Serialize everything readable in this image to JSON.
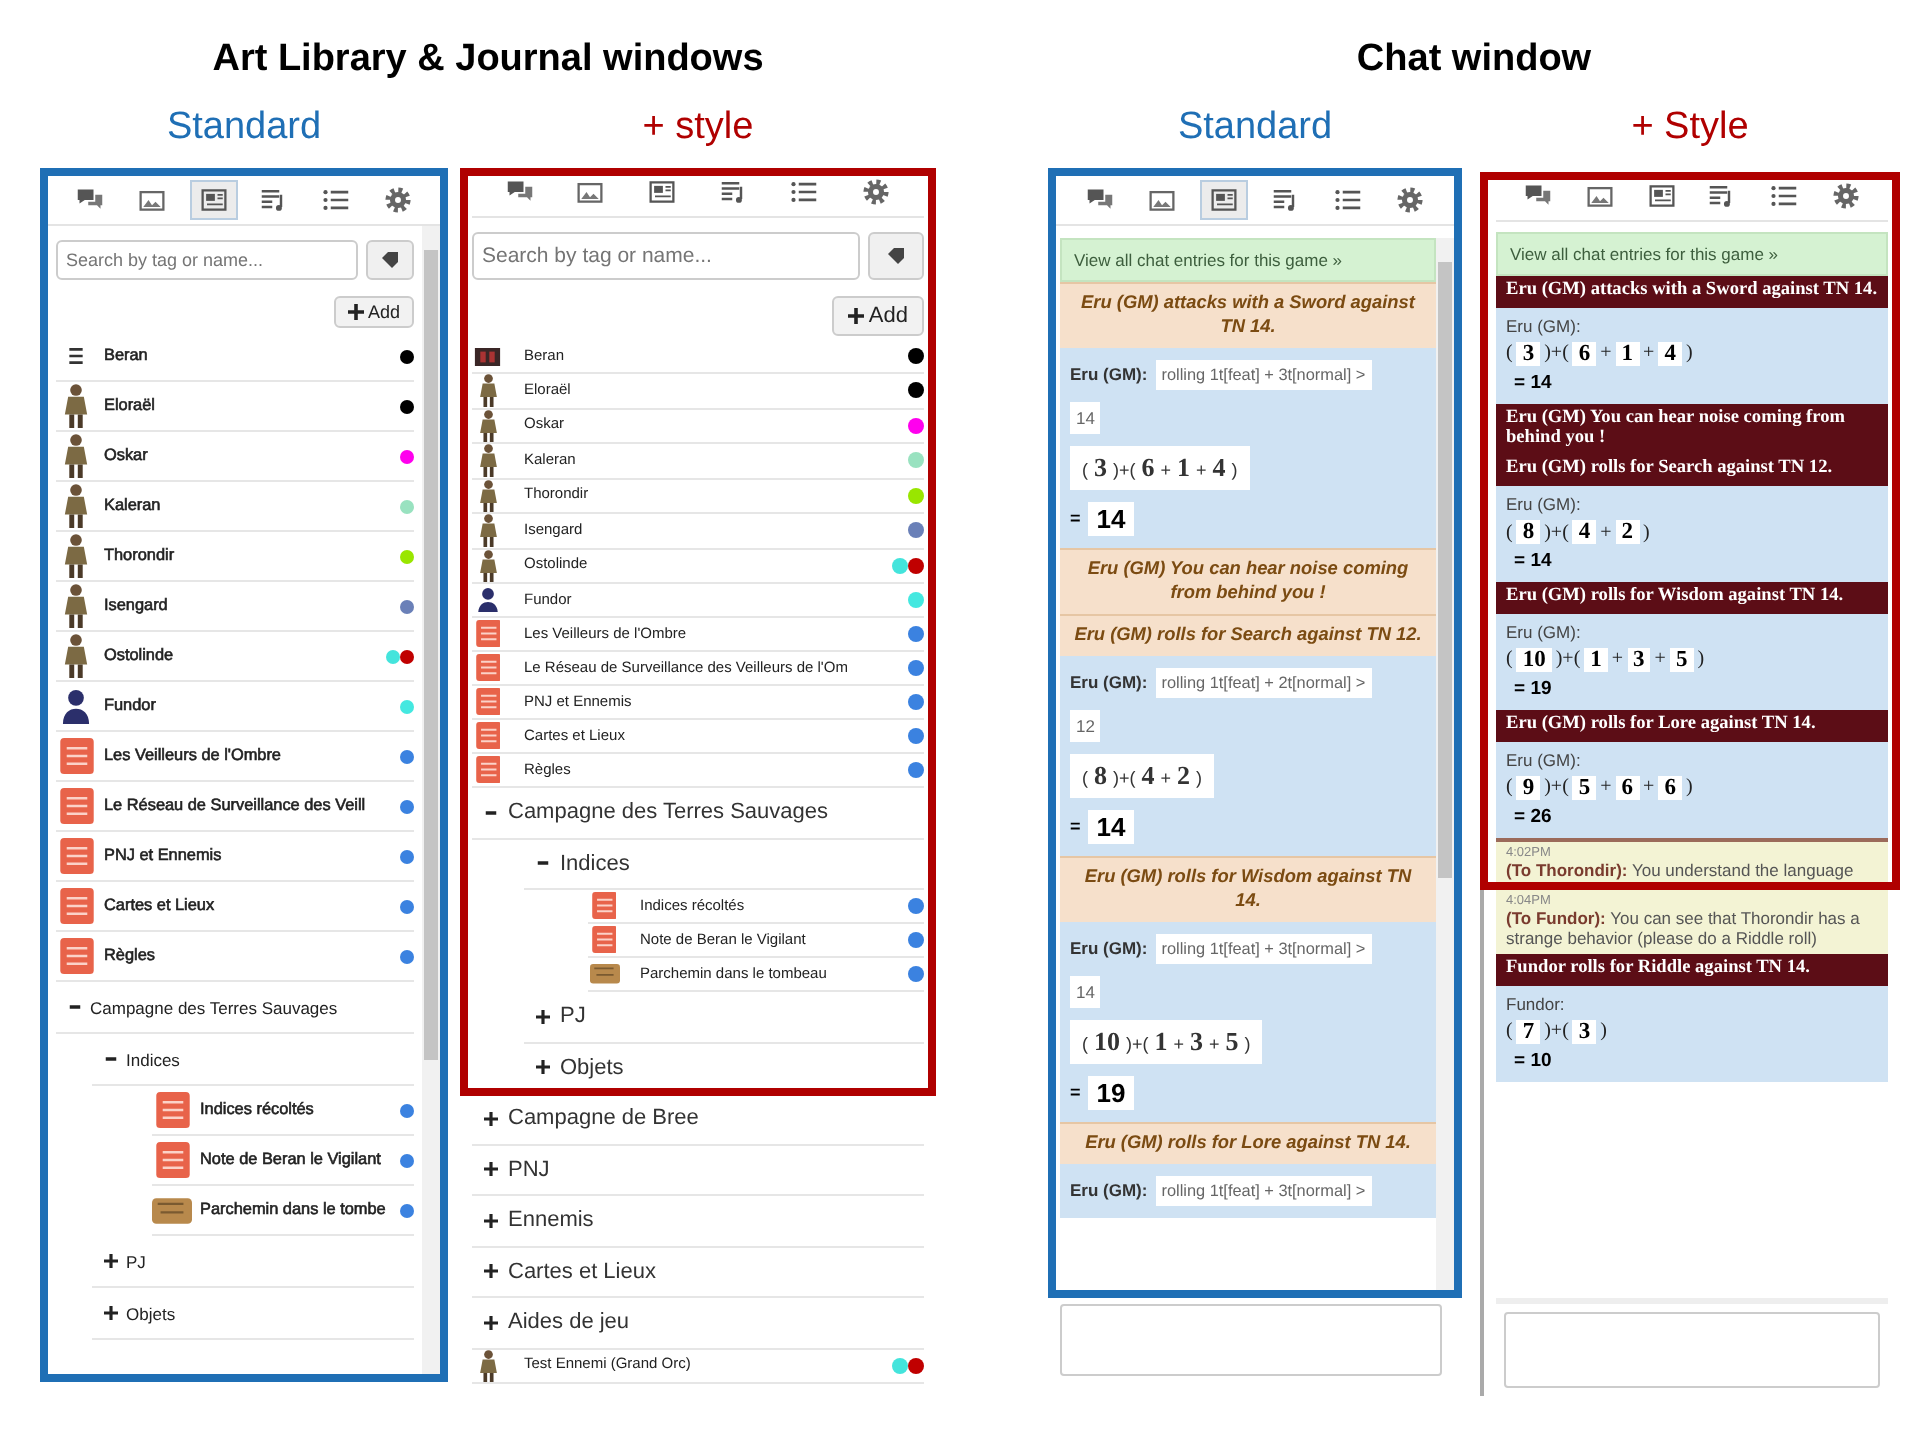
{
  "sections": [
    {
      "title": "Art Library & Journal windows",
      "panels": [
        {
          "kind": "library",
          "caption": "Standard",
          "color": "#1f6fb5",
          "tabs": [
            {
              "kind": "chat",
              "selected": false
            },
            {
              "kind": "art",
              "selected": false
            },
            {
              "kind": "journal",
              "selected": true
            },
            {
              "kind": "jukebox",
              "selected": false
            },
            {
              "kind": "list",
              "selected": false
            },
            {
              "kind": "settings",
              "selected": false
            }
          ],
          "search": {
            "placeholder": "Search by tag or name..."
          },
          "add_button": "Add",
          "items": [
            {
              "kind": "lines",
              "name": "Beran",
              "tags": [
                {
                  "color": "#000000"
                }
              ]
            },
            {
              "kind": "character",
              "name": "Eloraël",
              "tags": [
                {
                  "color": "#000000"
                }
              ]
            },
            {
              "kind": "character",
              "name": "Oskar",
              "tags": [
                {
                  "color": "#ff00ee"
                }
              ]
            },
            {
              "kind": "character",
              "name": "Kaleran",
              "tags": [
                {
                  "color": "#99e2c0"
                }
              ]
            },
            {
              "kind": "character",
              "name": "Thorondir",
              "tags": [
                {
                  "color": "#99e600"
                }
              ]
            },
            {
              "kind": "character",
              "name": "Isengard",
              "tags": [
                {
                  "color": "#6a80b8"
                }
              ]
            },
            {
              "kind": "character",
              "name": "Ostolinde",
              "tags": [
                {
                  "color": "#44e4dc"
                },
                {
                  "color": "#c00000"
                }
              ]
            },
            {
              "kind": "player",
              "name": "Fundor",
              "tags": [
                {
                  "color": "#44e8e0"
                }
              ]
            },
            {
              "kind": "handout",
              "name": "Les Veilleurs de l'Ombre",
              "tags": [
                {
                  "color": "#3b82e0"
                }
              ]
            },
            {
              "kind": "handout",
              "name": "Le Réseau de Surveillance des Veill",
              "tags": [
                {
                  "color": "#3b82e0"
                }
              ]
            },
            {
              "kind": "handout",
              "name": "PNJ et Ennemis",
              "tags": [
                {
                  "color": "#3b82e0"
                }
              ]
            },
            {
              "kind": "handout",
              "name": "Cartes et Lieux",
              "tags": [
                {
                  "color": "#3b82e0"
                }
              ]
            },
            {
              "kind": "handout",
              "name": "Règles",
              "tags": [
                {
                  "color": "#3b82e0"
                }
              ]
            },
            {
              "kind": "folder",
              "name": "Campagne des Terres Sauvages",
              "expanded": true,
              "children": [
                {
                  "kind": "folder",
                  "name": "Indices",
                  "expanded": true,
                  "children": [
                    {
                      "kind": "handout",
                      "name": "Indices récoltés",
                      "tags": [
                        {
                          "color": "#3b82e0"
                        }
                      ]
                    },
                    {
                      "kind": "handout",
                      "name": "Note de Beran le Vigilant",
                      "tags": [
                        {
                          "color": "#3b82e0"
                        }
                      ]
                    },
                    {
                      "kind": "scroll",
                      "name": "Parchemin dans le tombe",
                      "tags": [
                        {
                          "color": "#3b82e0"
                        }
                      ]
                    }
                  ]
                },
                {
                  "kind": "folder",
                  "name": "PJ",
                  "expanded": false
                },
                {
                  "kind": "folder",
                  "name": "Objets",
                  "expanded": false
                }
              ]
            }
          ]
        },
        {
          "kind": "library",
          "caption": "+ style",
          "color": "#b00000",
          "tabs": [
            {
              "kind": "chat",
              "selected": false
            },
            {
              "kind": "art",
              "selected": false
            },
            {
              "kind": "journal",
              "selected": false
            },
            {
              "kind": "jukebox",
              "selected": false
            },
            {
              "kind": "list",
              "selected": false
            },
            {
              "kind": "settings",
              "selected": false
            }
          ],
          "search": {
            "placeholder": "Search by tag or name..."
          },
          "add_button": "Add",
          "items": [
            {
              "kind": "banner",
              "name": "Beran",
              "tags": [
                {
                  "color": "#000000"
                }
              ]
            },
            {
              "kind": "character",
              "name": "Eloraël",
              "tags": [
                {
                  "color": "#000000"
                }
              ]
            },
            {
              "kind": "character",
              "name": "Oskar",
              "tags": [
                {
                  "color": "#ff00ee"
                }
              ]
            },
            {
              "kind": "character",
              "name": "Kaleran",
              "tags": [
                {
                  "color": "#99e2c0"
                }
              ]
            },
            {
              "kind": "character",
              "name": "Thorondir",
              "tags": [
                {
                  "color": "#99e600"
                }
              ]
            },
            {
              "kind": "character",
              "name": "Isengard",
              "tags": [
                {
                  "color": "#6a80b8"
                }
              ]
            },
            {
              "kind": "character",
              "name": "Ostolinde",
              "tags": [
                {
                  "color": "#44e4dc"
                },
                {
                  "color": "#c00000"
                }
              ]
            },
            {
              "kind": "player",
              "name": "Fundor",
              "tags": [
                {
                  "color": "#44e8e0"
                }
              ]
            },
            {
              "kind": "handout",
              "name": "Les Veilleurs de l'Ombre",
              "tags": [
                {
                  "color": "#3b82e0"
                }
              ]
            },
            {
              "kind": "handout",
              "name": "Le Réseau de Surveillance des Veilleurs de l'Om",
              "tags": [
                {
                  "color": "#3b82e0"
                }
              ]
            },
            {
              "kind": "handout",
              "name": "PNJ et Ennemis",
              "tags": [
                {
                  "color": "#3b82e0"
                }
              ]
            },
            {
              "kind": "handout",
              "name": "Cartes et Lieux",
              "tags": [
                {
                  "color": "#3b82e0"
                }
              ]
            },
            {
              "kind": "handout",
              "name": "Règles",
              "tags": [
                {
                  "color": "#3b82e0"
                }
              ]
            },
            {
              "kind": "folder",
              "name": "Campagne des Terres Sauvages",
              "expanded": true,
              "children": [
                {
                  "kind": "folder",
                  "name": "Indices",
                  "expanded": true,
                  "children": [
                    {
                      "kind": "handout",
                      "name": "Indices récoltés",
                      "tags": [
                        {
                          "color": "#3b82e0"
                        }
                      ]
                    },
                    {
                      "kind": "handout",
                      "name": "Note de Beran le Vigilant",
                      "tags": [
                        {
                          "color": "#3b82e0"
                        }
                      ]
                    },
                    {
                      "kind": "scroll",
                      "name": "Parchemin dans le tombeau",
                      "tags": [
                        {
                          "color": "#3b82e0"
                        }
                      ]
                    }
                  ]
                },
                {
                  "kind": "folder",
                  "name": "PJ",
                  "expanded": false
                },
                {
                  "kind": "folder",
                  "name": "Objets",
                  "expanded": false
                }
              ]
            },
            {
              "kind": "folder",
              "name": "Campagne de Bree",
              "expanded": false
            },
            {
              "kind": "folder",
              "name": "PNJ",
              "expanded": false
            },
            {
              "kind": "folder",
              "name": "Ennemis",
              "expanded": false
            },
            {
              "kind": "folder",
              "name": "Cartes et Lieux",
              "expanded": false
            },
            {
              "kind": "folder",
              "name": "Aides de jeu",
              "expanded": false
            },
            {
              "kind": "character",
              "name": "Test Ennemi (Grand Orc)",
              "tags": [
                {
                  "color": "#44e4dc"
                },
                {
                  "color": "#c00000"
                }
              ]
            }
          ]
        }
      ]
    },
    {
      "title": "Chat window",
      "panels": [
        {
          "kind": "chat",
          "caption": "Standard",
          "color": "#1f6fb5",
          "tabs": [
            {
              "kind": "chat",
              "selected": false
            },
            {
              "kind": "art",
              "selected": false
            },
            {
              "kind": "journal",
              "selected": true
            },
            {
              "kind": "jukebox",
              "selected": false
            },
            {
              "kind": "list",
              "selected": false
            },
            {
              "kind": "settings",
              "selected": false
            }
          ],
          "link": "View all chat entries for this game »",
          "message_box": true,
          "messages": [
            {
              "kind": "emote",
              "text": "Eru (GM) attacks with a Sword against TN 14."
            },
            {
              "kind": "roll",
              "name": "Eru (GM):",
              "formula": "rolling 1t[feat] + 3t[normal] >",
              "target": "14",
              "dice": [
                {
                  "kind": "op",
                  "text": "("
                },
                {
                  "kind": "die",
                  "text": "3"
                },
                {
                  "kind": "op",
                  "text": ")+("
                },
                {
                  "kind": "die",
                  "text": "6"
                },
                {
                  "kind": "op",
                  "text": "+"
                },
                {
                  "kind": "die",
                  "text": "1"
                },
                {
                  "kind": "op",
                  "text": "+"
                },
                {
                  "kind": "die",
                  "text": "4"
                },
                {
                  "kind": "op",
                  "text": ")"
                }
              ],
              "total": {
                "sign": "=",
                "value": "14"
              }
            },
            {
              "kind": "emote",
              "text": "Eru (GM) You can hear noise coming from behind you !"
            },
            {
              "kind": "emote",
              "text": "Eru (GM) rolls for Search against TN 12."
            },
            {
              "kind": "roll",
              "name": "Eru (GM):",
              "formula": "rolling 1t[feat] + 2t[normal] >",
              "target": "12",
              "dice": [
                {
                  "kind": "op",
                  "text": "("
                },
                {
                  "kind": "die",
                  "text": "8"
                },
                {
                  "kind": "op",
                  "text": ")+("
                },
                {
                  "kind": "die",
                  "text": "4"
                },
                {
                  "kind": "op",
                  "text": "+"
                },
                {
                  "kind": "die",
                  "text": "2"
                },
                {
                  "kind": "op",
                  "text": ")"
                }
              ],
              "total": {
                "sign": "=",
                "value": "14"
              }
            },
            {
              "kind": "emote",
              "text": "Eru (GM) rolls for Wisdom against TN 14."
            },
            {
              "kind": "roll",
              "name": "Eru (GM):",
              "formula": "rolling 1t[feat] + 3t[normal] >",
              "target": "14",
              "dice": [
                {
                  "kind": "op",
                  "text": "("
                },
                {
                  "kind": "die",
                  "text": "10"
                },
                {
                  "kind": "op",
                  "text": ")+("
                },
                {
                  "kind": "die",
                  "text": "1"
                },
                {
                  "kind": "op",
                  "text": "+"
                },
                {
                  "kind": "die",
                  "text": "3"
                },
                {
                  "kind": "op",
                  "text": "+"
                },
                {
                  "kind": "die",
                  "text": "5"
                },
                {
                  "kind": "op",
                  "text": ")"
                }
              ],
              "total": {
                "sign": "=",
                "value": "19"
              }
            },
            {
              "kind": "emote",
              "text": "Eru (GM) rolls for Lore against TN 14."
            },
            {
              "kind": "roll",
              "name": "Eru (GM):",
              "formula": "rolling 1t[feat] + 3t[normal] >"
            }
          ]
        },
        {
          "kind": "chat",
          "caption": "+ Style",
          "color": "#b00000",
          "tabs": [
            {
              "kind": "chat",
              "selected": false
            },
            {
              "kind": "art",
              "selected": false
            },
            {
              "kind": "journal",
              "selected": false
            },
            {
              "kind": "jukebox",
              "selected": false
            },
            {
              "kind": "list",
              "selected": false
            },
            {
              "kind": "settings",
              "selected": false
            }
          ],
          "link": "View all chat entries for this game »",
          "message_box": true,
          "messages": [
            {
              "kind": "emote",
              "text": "Eru (GM) attacks with a Sword against TN 14."
            },
            {
              "kind": "roll",
              "name": "Eru (GM):",
              "dice": [
                {
                  "kind": "op",
                  "text": "("
                },
                {
                  "kind": "die",
                  "text": "3"
                },
                {
                  "kind": "op",
                  "text": ")+("
                },
                {
                  "kind": "die",
                  "text": "6"
                },
                {
                  "kind": "op",
                  "text": "+"
                },
                {
                  "kind": "die",
                  "text": "1"
                },
                {
                  "kind": "op",
                  "text": "+"
                },
                {
                  "kind": "die",
                  "text": "4"
                },
                {
                  "kind": "op",
                  "text": ")"
                }
              ],
              "total": {
                "sign": "=",
                "value": "14"
              }
            },
            {
              "kind": "emote",
              "text": "Eru (GM) You can hear noise coming from behind you !"
            },
            {
              "kind": "emote",
              "text": "Eru (GM) rolls for Search against TN 12."
            },
            {
              "kind": "roll",
              "name": "Eru (GM):",
              "dice": [
                {
                  "kind": "op",
                  "text": "("
                },
                {
                  "kind": "die",
                  "text": "8"
                },
                {
                  "kind": "op",
                  "text": ")+("
                },
                {
                  "kind": "die",
                  "text": "4"
                },
                {
                  "kind": "op",
                  "text": "+"
                },
                {
                  "kind": "die",
                  "text": "2"
                },
                {
                  "kind": "op",
                  "text": ")"
                }
              ],
              "total": {
                "sign": "=",
                "value": "14"
              }
            },
            {
              "kind": "emote",
              "text": "Eru (GM) rolls for Wisdom against TN 14."
            },
            {
              "kind": "roll",
              "name": "Eru (GM):",
              "dice": [
                {
                  "kind": "op",
                  "text": "("
                },
                {
                  "kind": "die",
                  "text": "10"
                },
                {
                  "kind": "op",
                  "text": ")+("
                },
                {
                  "kind": "die",
                  "text": "1"
                },
                {
                  "kind": "op",
                  "text": "+"
                },
                {
                  "kind": "die",
                  "text": "3"
                },
                {
                  "kind": "op",
                  "text": "+"
                },
                {
                  "kind": "die",
                  "text": "5"
                },
                {
                  "kind": "op",
                  "text": ")"
                }
              ],
              "total": {
                "sign": "=",
                "value": "19"
              }
            },
            {
              "kind": "emote",
              "text": "Eru (GM) rolls for Lore against TN 14."
            },
            {
              "kind": "roll",
              "name": "Eru (GM):",
              "dice": [
                {
                  "kind": "op",
                  "text": "("
                },
                {
                  "kind": "die",
                  "text": "9"
                },
                {
                  "kind": "op",
                  "text": ")+("
                },
                {
                  "kind": "die",
                  "text": "5"
                },
                {
                  "kind": "op",
                  "text": "+"
                },
                {
                  "kind": "die",
                  "text": "6"
                },
                {
                  "kind": "op",
                  "text": "+"
                },
                {
                  "kind": "die",
                  "text": "6"
                },
                {
                  "kind": "op",
                  "text": ")"
                }
              ],
              "total": {
                "sign": "=",
                "value": "26"
              }
            },
            {
              "kind": "whisper",
              "time": "4:02PM",
              "to": "(To Thorondir):",
              "text": "You understand the language"
            },
            {
              "kind": "whisper",
              "time": "4:04PM",
              "to": "(To Fundor):",
              "text": "You can see that Thorondir has a strange behavior (please do a Riddle roll)"
            },
            {
              "kind": "emote",
              "text": "Fundor rolls for Riddle against TN 14."
            },
            {
              "kind": "roll",
              "name": "Fundor:",
              "dice": [
                {
                  "kind": "op",
                  "text": "("
                },
                {
                  "kind": "die",
                  "text": "7"
                },
                {
                  "kind": "op",
                  "text": ")+("
                },
                {
                  "kind": "die",
                  "text": "3"
                },
                {
                  "kind": "op",
                  "text": ")"
                }
              ],
              "total": {
                "sign": "=",
                "value": "10"
              }
            }
          ]
        }
      ]
    }
  ]
}
